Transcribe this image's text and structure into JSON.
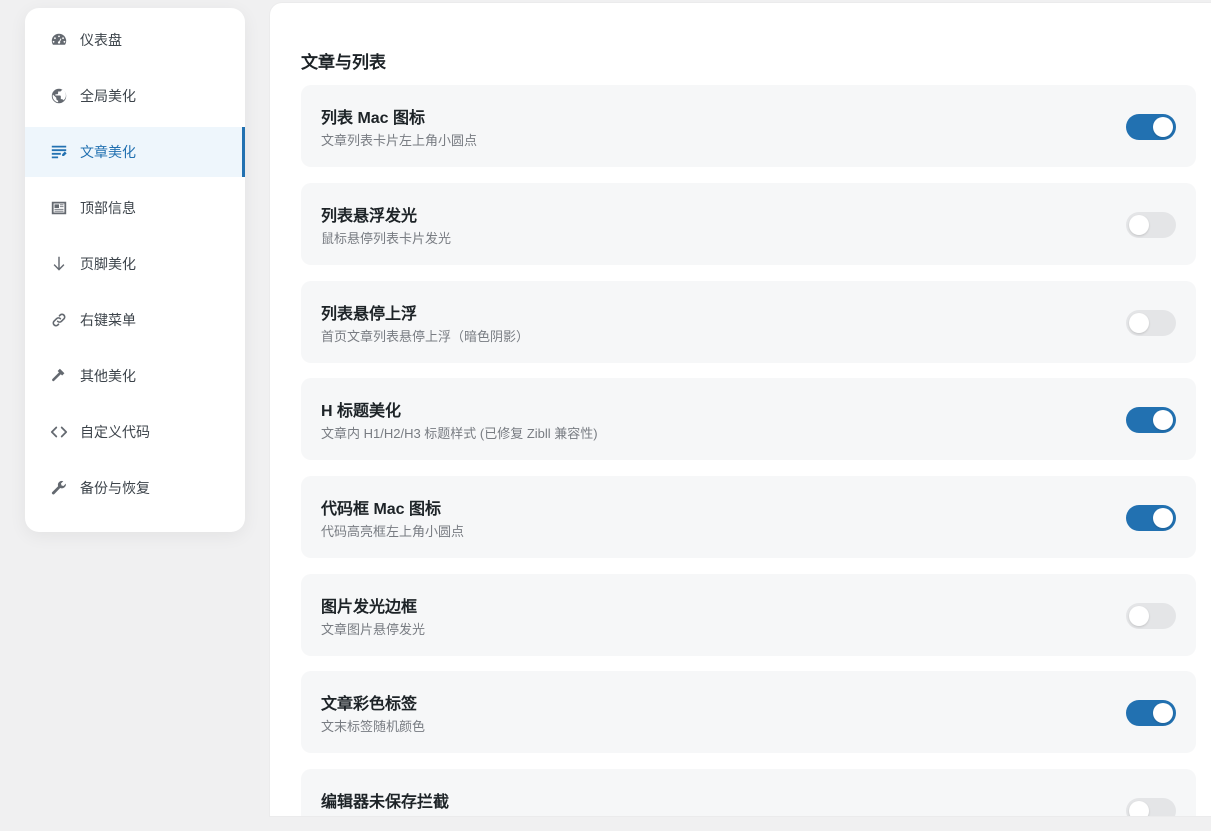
{
  "colors": {
    "accent": "#2271b1",
    "toggle_on": "#2271b1",
    "toggle_off": "#e4e5e7"
  },
  "sidebar": {
    "items": [
      {
        "label": "仪表盘",
        "icon": "dashboard-icon",
        "active": false
      },
      {
        "label": "全局美化",
        "icon": "globe-icon",
        "active": false
      },
      {
        "label": "文章美化",
        "icon": "post-edit-icon",
        "active": true
      },
      {
        "label": "顶部信息",
        "icon": "id-card-icon",
        "active": false
      },
      {
        "label": "页脚美化",
        "icon": "arrow-down-icon",
        "active": false
      },
      {
        "label": "右键菜单",
        "icon": "link-icon",
        "active": false
      },
      {
        "label": "其他美化",
        "icon": "hammer-icon",
        "active": false
      },
      {
        "label": "自定义代码",
        "icon": "code-icon",
        "active": false
      },
      {
        "label": "备份与恢复",
        "icon": "wrench-icon",
        "active": false
      }
    ]
  },
  "main": {
    "section_title": "文章与列表",
    "settings": [
      {
        "title": "列表 Mac 图标",
        "desc": "文章列表卡片左上角小圆点",
        "enabled": true
      },
      {
        "title": "列表悬浮发光",
        "desc": "鼠标悬停列表卡片发光",
        "enabled": false
      },
      {
        "title": "列表悬停上浮",
        "desc": "首页文章列表悬停上浮（暗色阴影）",
        "enabled": false
      },
      {
        "title": "H 标题美化",
        "desc": "文章内 H1/H2/H3 标题样式 (已修复 Zibll 兼容性)",
        "enabled": true
      },
      {
        "title": "代码框 Mac 图标",
        "desc": "代码高亮框左上角小圆点",
        "enabled": true
      },
      {
        "title": "图片发光边框",
        "desc": "文章图片悬停发光",
        "enabled": false
      },
      {
        "title": "文章彩色标签",
        "desc": "文末标签随机颜色",
        "enabled": true
      },
      {
        "title": "编辑器未保存拦截",
        "desc": "",
        "enabled": false
      }
    ]
  }
}
